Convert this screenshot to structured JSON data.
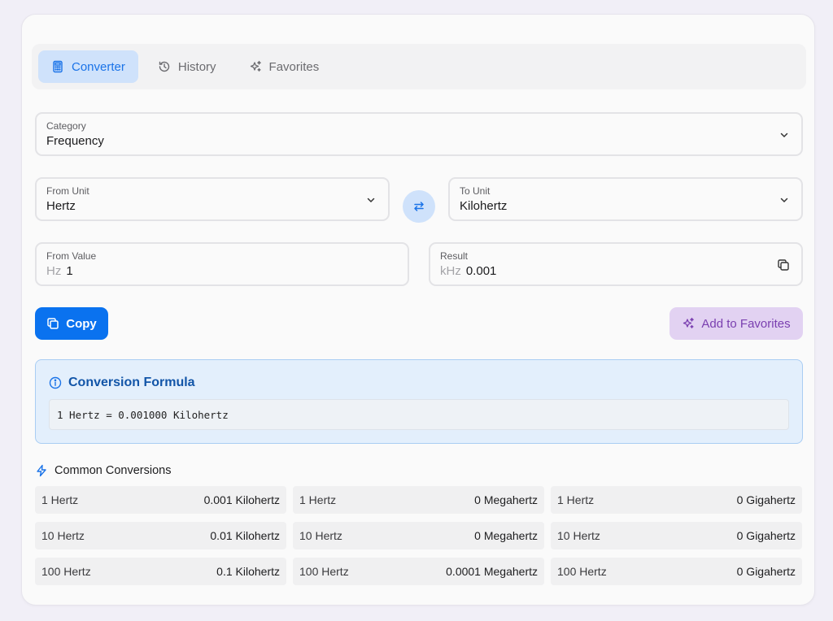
{
  "tabs": [
    {
      "label": "Converter",
      "icon": "calculator-icon",
      "active": true
    },
    {
      "label": "History",
      "icon": "history-icon"
    },
    {
      "label": "Favorites",
      "icon": "sparkles-icon"
    }
  ],
  "category": {
    "label": "Category",
    "value": "Frequency"
  },
  "from_unit": {
    "label": "From Unit",
    "value": "Hertz"
  },
  "to_unit": {
    "label": "To Unit",
    "value": "Kilohertz"
  },
  "from_value": {
    "label": "From Value",
    "unit": "Hz",
    "value": "1"
  },
  "result": {
    "label": "Result",
    "unit": "kHz",
    "value": "0.001"
  },
  "actions": {
    "copy_label": "Copy",
    "favorites_label": "Add to Favorites"
  },
  "formula": {
    "title": "Conversion Formula",
    "text": "1 Hertz = 0.001000 Kilohertz"
  },
  "common": {
    "title": "Common Conversions",
    "rows": [
      [
        {
          "from": "1 Hertz",
          "to": "0.001 Kilohertz"
        },
        {
          "from": "1 Hertz",
          "to": "0 Megahertz"
        },
        {
          "from": "1 Hertz",
          "to": "0 Gigahertz"
        }
      ],
      [
        {
          "from": "10 Hertz",
          "to": "0.01 Kilohertz"
        },
        {
          "from": "10 Hertz",
          "to": "0 Megahertz"
        },
        {
          "from": "10 Hertz",
          "to": "0 Gigahertz"
        }
      ],
      [
        {
          "from": "100 Hertz",
          "to": "0.1 Kilohertz"
        },
        {
          "from": "100 Hertz",
          "to": "0.0001 Megahertz"
        },
        {
          "from": "100 Hertz",
          "to": "0 Gigahertz"
        }
      ]
    ]
  },
  "colors": {
    "accent": "#0a72ef",
    "tab_active_bg": "#cfe2fb",
    "favorite_bg": "#e2d2f2",
    "formula_bg": "#e3effc"
  }
}
